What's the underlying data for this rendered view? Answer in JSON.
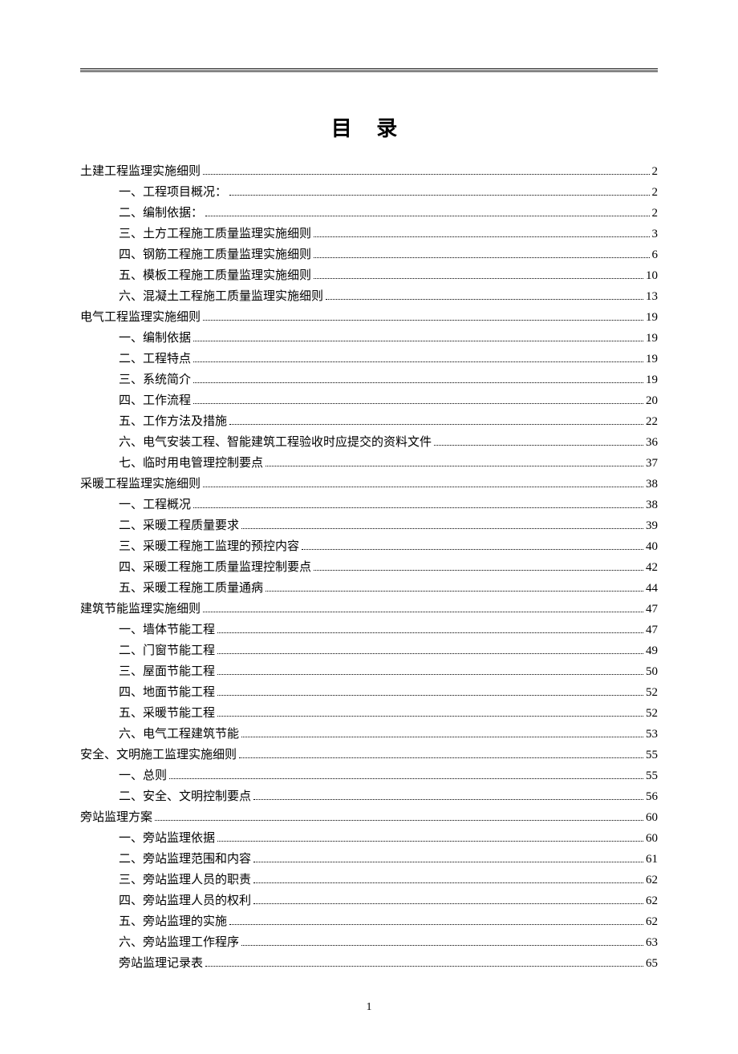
{
  "title": "目 录",
  "page_number": "1",
  "toc": [
    {
      "level": 1,
      "label": "土建工程监理实施细则",
      "page": "2"
    },
    {
      "level": 2,
      "label": "一、工程项目概况：",
      "page": "2"
    },
    {
      "level": 2,
      "label": "二、编制依据：",
      "page": "2"
    },
    {
      "level": 2,
      "label": "三、土方工程施工质量监理实施细则",
      "page": "3"
    },
    {
      "level": 2,
      "label": "四、钢筋工程施工质量监理实施细则",
      "page": "6"
    },
    {
      "level": 2,
      "label": "五、模板工程施工质量监理实施细则",
      "page": "10"
    },
    {
      "level": 2,
      "label": "六、混凝土工程施工质量监理实施细则",
      "page": "13"
    },
    {
      "level": 1,
      "label": "电气工程监理实施细则",
      "page": "19"
    },
    {
      "level": 2,
      "label": "一、编制依据",
      "page": "19"
    },
    {
      "level": 2,
      "label": "二、工程特点",
      "page": "19"
    },
    {
      "level": 2,
      "label": "三、系统简介",
      "page": "19"
    },
    {
      "level": 2,
      "label": "四、工作流程",
      "page": "20"
    },
    {
      "level": 2,
      "label": "五、工作方法及措施",
      "page": "22"
    },
    {
      "level": 2,
      "label": "六、电气安装工程、智能建筑工程验收时应提交的资料文件",
      "page": "36"
    },
    {
      "level": 2,
      "label": "七、临时用电管理控制要点",
      "page": "37"
    },
    {
      "level": 1,
      "label": "采暖工程监理实施细则",
      "page": "38"
    },
    {
      "level": 2,
      "label": "一、工程概况",
      "page": "38"
    },
    {
      "level": 2,
      "label": "二、采暖工程质量要求",
      "page": "39"
    },
    {
      "level": 2,
      "label": "三、采暖工程施工监理的预控内容",
      "page": "40"
    },
    {
      "level": 2,
      "label": "四、采暖工程施工质量监理控制要点",
      "page": "42"
    },
    {
      "level": 2,
      "label": "五、采暖工程施工质量通病",
      "page": "44"
    },
    {
      "level": 1,
      "label": "建筑节能监理实施细则",
      "page": "47"
    },
    {
      "level": 2,
      "label": "一、墙体节能工程",
      "page": "47"
    },
    {
      "level": 2,
      "label": "二、门窗节能工程",
      "page": "49"
    },
    {
      "level": 2,
      "label": "三、屋面节能工程",
      "page": "50"
    },
    {
      "level": 2,
      "label": "四、地面节能工程",
      "page": "52"
    },
    {
      "level": 2,
      "label": "五、采暖节能工程",
      "page": "52"
    },
    {
      "level": 2,
      "label": "六、电气工程建筑节能",
      "page": "53"
    },
    {
      "level": 1,
      "label": "安全、文明施工监理实施细则",
      "page": "55"
    },
    {
      "level": 2,
      "label": "一、总则",
      "page": "55"
    },
    {
      "level": 2,
      "label": "二、安全、文明控制要点",
      "page": "56"
    },
    {
      "level": 1,
      "label": "旁站监理方案",
      "page": "60"
    },
    {
      "level": 2,
      "label": "一、旁站监理依据",
      "page": "60"
    },
    {
      "level": 2,
      "label": "二、旁站监理范围和内容",
      "page": "61"
    },
    {
      "level": 2,
      "label": "三、旁站监理人员的职责",
      "page": "62"
    },
    {
      "level": 2,
      "label": "四、旁站监理人员的权利",
      "page": "62"
    },
    {
      "level": 2,
      "label": "五、旁站监理的实施",
      "page": "62"
    },
    {
      "level": 2,
      "label": "六、旁站监理工作程序",
      "page": "63"
    },
    {
      "level": 2,
      "label": "旁站监理记录表",
      "page": "65"
    }
  ]
}
